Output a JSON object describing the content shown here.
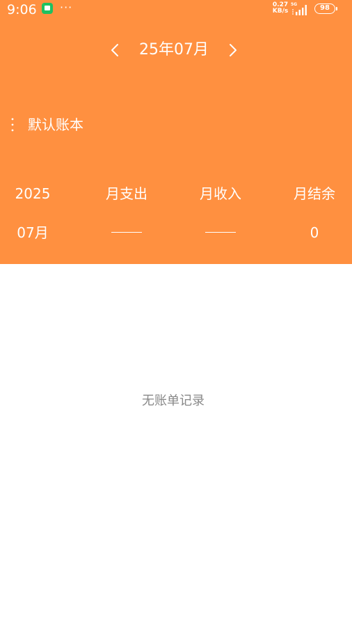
{
  "status_bar": {
    "time": "9:06",
    "more_dots": "···",
    "net_speed_value": "0.27",
    "net_speed_unit": "KB/s",
    "network_type": "5G",
    "battery": "98"
  },
  "month_nav": {
    "title": "25年07月",
    "prev_icon": "chevron-left-icon",
    "next_icon": "chevron-right-icon"
  },
  "book": {
    "name": "默认账本",
    "icon": "more-vertical-icon"
  },
  "summary": {
    "year": "2025",
    "month": "07月",
    "headers": [
      "月支出",
      "月收入",
      "月结余"
    ],
    "expense": "",
    "income": "",
    "balance": "0"
  },
  "empty_state": {
    "text": "无账单记录"
  },
  "colors": {
    "header_background": "#FF9040",
    "text_on_header": "#FFFFFF",
    "empty_text": "#888888",
    "status_app_icon": "#20C060"
  }
}
